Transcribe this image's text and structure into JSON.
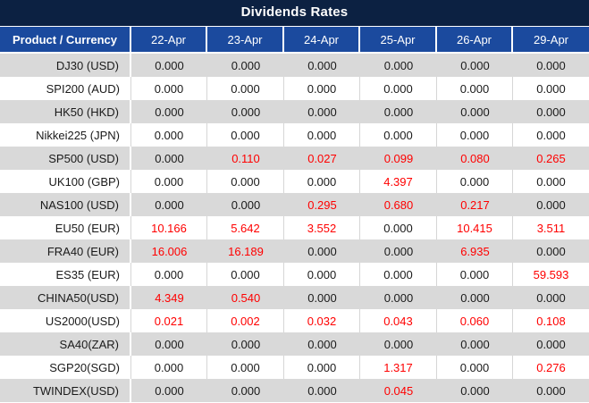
{
  "title": "Dividends Rates",
  "table": {
    "columns": [
      "Product / Currency",
      "22-Apr",
      "23-Apr",
      "24-Apr",
      "25-Apr",
      "26-Apr",
      "29-Apr"
    ],
    "rows": [
      {
        "label": "DJ30 (USD)",
        "values": [
          "0.000",
          "0.000",
          "0.000",
          "0.000",
          "0.000",
          "0.000"
        ]
      },
      {
        "label": "SPI200 (AUD)",
        "values": [
          "0.000",
          "0.000",
          "0.000",
          "0.000",
          "0.000",
          "0.000"
        ]
      },
      {
        "label": "HK50 (HKD)",
        "values": [
          "0.000",
          "0.000",
          "0.000",
          "0.000",
          "0.000",
          "0.000"
        ]
      },
      {
        "label": "Nikkei225 (JPN)",
        "values": [
          "0.000",
          "0.000",
          "0.000",
          "0.000",
          "0.000",
          "0.000"
        ]
      },
      {
        "label": "SP500 (USD)",
        "values": [
          "0.000",
          "0.110",
          "0.027",
          "0.099",
          "0.080",
          "0.265"
        ]
      },
      {
        "label": "UK100 (GBP)",
        "values": [
          "0.000",
          "0.000",
          "0.000",
          "4.397",
          "0.000",
          "0.000"
        ]
      },
      {
        "label": "NAS100 (USD)",
        "values": [
          "0.000",
          "0.000",
          "0.295",
          "0.680",
          "0.217",
          "0.000"
        ]
      },
      {
        "label": "EU50 (EUR)",
        "values": [
          "10.166",
          "5.642",
          "3.552",
          "0.000",
          "10.415",
          "3.511"
        ]
      },
      {
        "label": "FRA40 (EUR)",
        "values": [
          "16.006",
          "16.189",
          "0.000",
          "0.000",
          "6.935",
          "0.000"
        ]
      },
      {
        "label": "ES35 (EUR)",
        "values": [
          "0.000",
          "0.000",
          "0.000",
          "0.000",
          "0.000",
          "59.593"
        ]
      },
      {
        "label": "CHINA50(USD)",
        "values": [
          "4.349",
          "0.540",
          "0.000",
          "0.000",
          "0.000",
          "0.000"
        ]
      },
      {
        "label": "US2000(USD)",
        "values": [
          "0.021",
          "0.002",
          "0.032",
          "0.043",
          "0.060",
          "0.108"
        ]
      },
      {
        "label": "SA40(ZAR)",
        "values": [
          "0.000",
          "0.000",
          "0.000",
          "0.000",
          "0.000",
          "0.000"
        ]
      },
      {
        "label": "SGP20(SGD)",
        "values": [
          "0.000",
          "0.000",
          "0.000",
          "1.317",
          "0.000",
          "0.276"
        ]
      },
      {
        "label": "TWINDEX(USD)",
        "values": [
          "0.000",
          "0.000",
          "0.000",
          "0.045",
          "0.000",
          "0.000"
        ]
      }
    ]
  },
  "colors": {
    "title_bg": "#0c2142",
    "header_bg": "#1b4a9e",
    "row_alt_bg": "#d9d9d9",
    "zero_text": "#1a1a1a",
    "nonzero_text": "#ff0000",
    "header_text": "#ffffff"
  }
}
